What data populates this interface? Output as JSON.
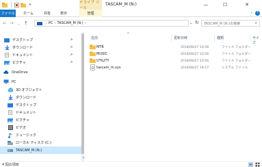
{
  "window": {
    "context_tab_label": "ドライブ ツール",
    "title": "TASCAM_M (N:)",
    "minimize_glyph": "—",
    "maximize_glyph": "☐",
    "close_glyph": "✕"
  },
  "ribbon": {
    "tabs": [
      "ファイル",
      "ホーム",
      "共有",
      "表示"
    ],
    "context_tab": "管理",
    "toggle_glyph": "⌄",
    "help_glyph": "?"
  },
  "address_bar": {
    "back_glyph": "←",
    "forward_glyph": "→",
    "recent_glyph": "⌄",
    "up_glyph": "↑",
    "crumbs": [
      "PC",
      "TASCAM_M (N:)"
    ],
    "separator": "›",
    "dropdown_glyph": "⌄",
    "refresh_glyph": "↻",
    "search_placeholder": "TASCAM_M (N:)の検索",
    "search_glyph": "⌕"
  },
  "nav_pane": {
    "items": [
      {
        "label": "デスクトップ",
        "icon": "desktop-icon",
        "pinned": true
      },
      {
        "label": "ダウンロード",
        "icon": "download-icon",
        "pinned": true
      },
      {
        "label": "ドキュメント",
        "icon": "documents-icon",
        "pinned": true
      },
      {
        "label": "ピクチャ",
        "icon": "pictures-icon",
        "pinned": true
      },
      {
        "label": "OneDrive",
        "icon": "onedrive-icon",
        "pinned": false
      },
      {
        "label": "PC",
        "icon": "pc-icon",
        "pinned": false
      },
      {
        "label": "3D オブジェクト",
        "icon": "3d-objects-icon",
        "pinned": false
      },
      {
        "label": "ダウンロード",
        "icon": "download-icon",
        "pinned": false
      },
      {
        "label": "デスクトップ",
        "icon": "desktop-icon",
        "pinned": false
      },
      {
        "label": "ドキュメント",
        "icon": "documents-icon",
        "pinned": false
      },
      {
        "label": "ピクチャ",
        "icon": "pictures-icon",
        "pinned": false
      },
      {
        "label": "ビデオ",
        "icon": "videos-icon",
        "pinned": false
      },
      {
        "label": "ミュージック",
        "icon": "music-icon",
        "pinned": false
      },
      {
        "label": "ローカル ディスク (C:)",
        "icon": "local-disk-icon",
        "pinned": false
      },
      {
        "label": "TASCAM_M (N:)",
        "icon": "usb-drive-icon",
        "pinned": false,
        "selected": true
      }
    ],
    "pin_glyph": "📌",
    "scroll_left_glyph": "<"
  },
  "file_list": {
    "columns": [
      "名前",
      "更新日時",
      "種類",
      "サイズ"
    ],
    "sort_glyph": "^",
    "rows": [
      {
        "name": "MTR",
        "modified": "2018/08/27 10:56",
        "type": "ファイル フォルダー",
        "icon": "folder-icon"
      },
      {
        "name": "MUSIC",
        "modified": "2018/08/27 10:56",
        "type": "ファイル フォルダー",
        "icon": "folder-icon"
      },
      {
        "name": "UTILITY",
        "modified": "2018/08/27 10:56",
        "type": "ファイル フォルダー",
        "icon": "folder-icon"
      },
      {
        "name": "tascam_m.sys",
        "modified": "2018/08/27 18:17",
        "type": "システム ファイル",
        "icon": "system-file-icon"
      }
    ]
  },
  "status_bar": {
    "item_count": "4 個の項目"
  },
  "colors": {
    "accent": "#1979ca",
    "context_tab_text": "#d06f14",
    "selection": "#cce8ff",
    "folder": "#f3c24c"
  }
}
